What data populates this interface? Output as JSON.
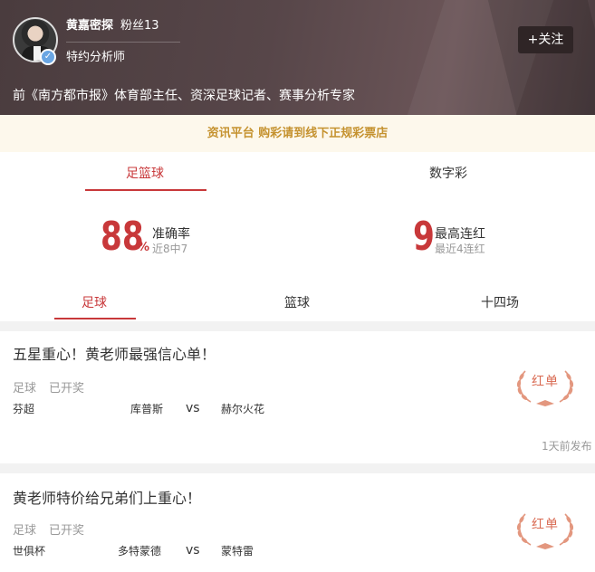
{
  "header": {
    "name": "黄嘉密探",
    "fans": "粉丝13",
    "role": "特约分析师",
    "follow_label": "+关注",
    "intro": "前《南方都市报》体育部主任、资深足球记者、赛事分析专家",
    "avatar_icon": "analyst-avatar",
    "verify_icon": "verified-badge-icon"
  },
  "notice": "资讯平台 购彩请到线下正规彩票店",
  "category_tabs": [
    "足篮球",
    "数字彩"
  ],
  "stats": {
    "accuracy_value": "88",
    "accuracy_unit": "%",
    "accuracy_label": "准确率",
    "accuracy_sub": "近8中7",
    "streak_value": "9",
    "streak_label": "最高连红",
    "streak_sub": "最近4连红"
  },
  "sport_tabs": [
    "足球",
    "篮球",
    "十四场"
  ],
  "cards": [
    {
      "title": "五星重心！黄老师最强信心单！",
      "sport": "足球",
      "status": "已开奖",
      "league": "芬超",
      "home": "库普斯",
      "vs": "vs",
      "away": "赫尔火花",
      "badge": "红单",
      "time": "1天前发布"
    },
    {
      "title": "黄老师特价给兄弟们上重心！",
      "sport": "足球",
      "status": "已开奖",
      "league": "世俱杯",
      "home": "多特蒙德",
      "vs": "vs",
      "away": "蒙特雷",
      "badge": "红单"
    }
  ],
  "colors": {
    "accent": "#c8383a",
    "notice_text": "#c5922f",
    "header_bg": "#574649",
    "laurel": "#d96a52"
  }
}
